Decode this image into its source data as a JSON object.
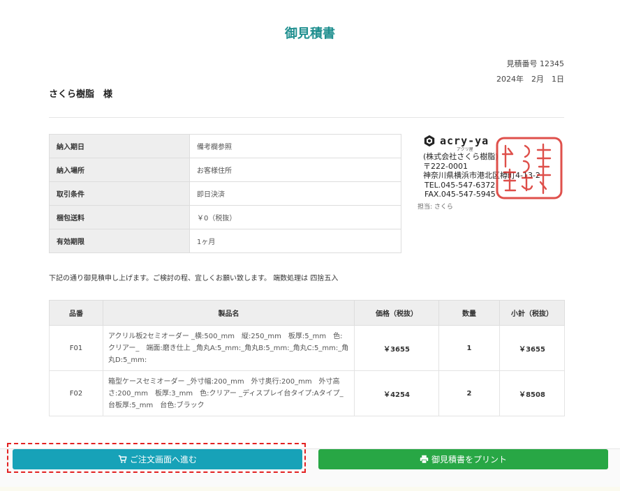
{
  "title": "御見積書",
  "quote_number": "見積番号 12345",
  "date": "2024年　2月　1日",
  "customer": "さくら樹脂　様",
  "info_rows": [
    {
      "label": "納入期日",
      "value": "備考欄参照"
    },
    {
      "label": "納入場所",
      "value": "お客様住所"
    },
    {
      "label": "取引条件",
      "value": "即日決済"
    },
    {
      "label": "梱包送料",
      "value": "￥0（税抜）"
    },
    {
      "label": "有効期限",
      "value": "1ヶ月"
    }
  ],
  "company": {
    "logo_text": "acry-ya",
    "logo_sub": "アクリ屋",
    "name": "(株式会社さくら樹脂)",
    "postal": "〒222-0001",
    "address": "神奈川県横浜市港北区樽町4-13-2",
    "tel": "TEL.045-547-6372",
    "fax": "FAX.045-547-5945",
    "person": "担当: さくら",
    "seal_text": "株式会社さくら樹脂之印"
  },
  "note": "下記の通り御見積申し上げます。ご検討の程、宜しくお願い致します。 端数処理は 四捨五入",
  "items_table": {
    "headers": [
      "品番",
      "製品名",
      "価格（税抜）",
      "数量",
      "小計（税抜）"
    ],
    "rows": [
      {
        "code": "F01",
        "name": "アクリル板2セミオーダー _横:500_mm　縦:250_mm　板厚:5_mm　色:クリアー_　端面:磨き仕上 _角丸A:5_mm:_角丸B:5_mm:_角丸C:5_mm:_角丸D:5_mm:",
        "price": "￥3655",
        "qty": "1",
        "subtotal": "￥3655"
      },
      {
        "code": "F02",
        "name": "箱型ケースセミオーダー _外寸幅:200_mm　外寸奥行:200_mm　外寸高さ:200_mm　板厚:3_mm　色:クリアー _ディスプレイ台タイプ:Aタイプ_　台板厚:5_mm　台色:ブラック",
        "price": "￥4254",
        "qty": "2",
        "subtotal": "￥8508"
      }
    ]
  },
  "buttons": {
    "order": "ご注文画面へ進む",
    "print": "御見積書をプリント"
  },
  "colors": {
    "title": "#1f8f8f",
    "order_button": "#17a2b8",
    "print_button": "#28a745",
    "highlight": "#e32222",
    "seal": "#d9312b"
  },
  "icons": {
    "order": "cart-icon",
    "print": "print-icon"
  }
}
